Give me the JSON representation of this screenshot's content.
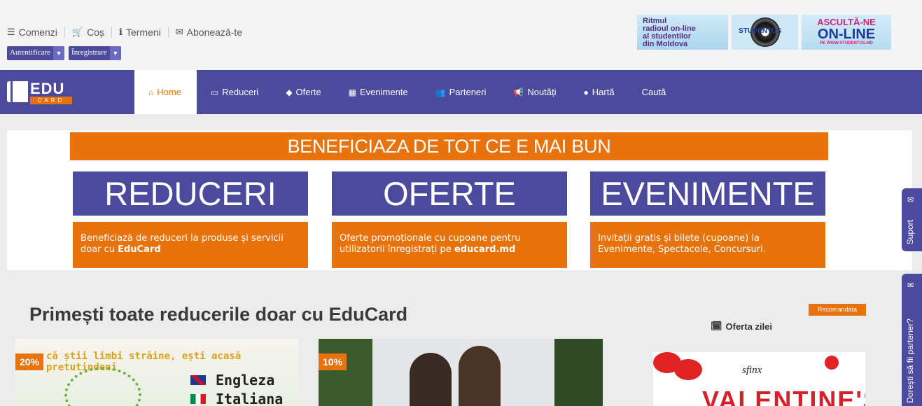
{
  "toplinks": [
    {
      "icon": "list-icon",
      "glyph": "☰",
      "label": "Comenzi"
    },
    {
      "icon": "cart-icon",
      "glyph": "🛒",
      "label": "Coș"
    },
    {
      "icon": "info-icon",
      "glyph": "ℹ",
      "label": "Termeni"
    },
    {
      "icon": "envelope-icon",
      "glyph": "✉",
      "label": "Abonează-te"
    }
  ],
  "auth": {
    "login": "Autentificare",
    "register": "Înregistrare"
  },
  "banners": {
    "radio_lines": [
      "Ritmul",
      "radioul on-line",
      "al studentilor",
      "din Moldova"
    ],
    "station": "STUDENTUS",
    "live_l1": "ASCULTĂ-NE",
    "live_l2": "ON-LINE",
    "live_l3": "PE WWW.STUDENTUS.MD"
  },
  "logo": {
    "edu": "EDU",
    "card": "CARD"
  },
  "nav": [
    {
      "label": "Home",
      "icon": "home-icon",
      "glyph": "⌂",
      "active": true
    },
    {
      "label": "Reduceri",
      "icon": "card-icon",
      "glyph": "▭"
    },
    {
      "label": "Oferte",
      "icon": "tag-icon",
      "glyph": "◆"
    },
    {
      "label": "Evenimente",
      "icon": "calendar-icon",
      "glyph": "▦"
    },
    {
      "label": "Parteneri",
      "icon": "users-icon",
      "glyph": "👥"
    },
    {
      "label": "Noutăți",
      "icon": "megaphone-icon",
      "glyph": "📢"
    },
    {
      "label": "Hartă",
      "icon": "map-marker-icon",
      "glyph": "●"
    },
    {
      "label": "Caută",
      "icon": "",
      "glyph": ""
    }
  ],
  "promo": {
    "headline": "BENEFICIAZA DE TOT CE E MAI BUN",
    "cards": [
      {
        "title": "REDUCERI",
        "desc_pre": "Beneficiază de reduceri la produse și servicii doar cu ",
        "desc_bold": "EduCard",
        "desc_post": ""
      },
      {
        "title": "OFERTE",
        "desc_pre": "Oferte promoționale cu cupoane pentru utilizatorii înregistrați pe ",
        "desc_bold": "educard.md",
        "desc_post": ""
      },
      {
        "title": "EVENIMENTE",
        "desc_pre": "Invitații gratis și bilete (cupoane) la Evenimente, Spectacole, Concursuri.",
        "desc_bold": "",
        "desc_post": ""
      }
    ]
  },
  "main": {
    "title": "Primești toate reducerile doar cu EduCard",
    "products": [
      {
        "discount": "20%",
        "slogan": "că știi limbi străine, ești acasă pretutindeni",
        "langs": [
          "Engleza",
          "Italiana"
        ]
      },
      {
        "discount": "10%"
      }
    ],
    "recommended": "Recomandata",
    "offer_label": "Oferta zilei",
    "offer_brand": "sfinx",
    "offer_text": "VALENTINE'S"
  },
  "sidetabs": {
    "support": "Suport",
    "partner": "Dorești să fii partener?"
  },
  "colors": {
    "primary": "#4b4a9c",
    "accent": "#e8720c"
  }
}
